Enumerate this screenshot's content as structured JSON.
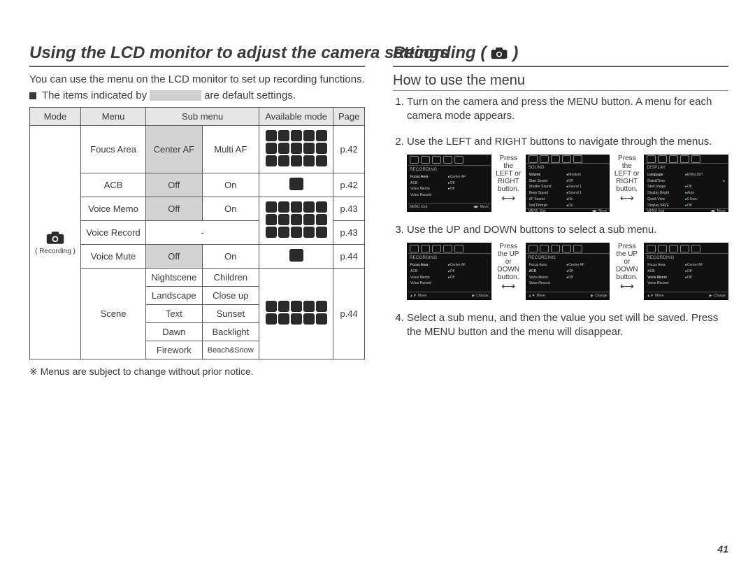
{
  "page_number": "41",
  "left": {
    "title": "Using the LCD monitor to adjust the camera settings",
    "intro": "You can use the menu on the LCD monitor to set up recording functions.",
    "default_pre": "The items indicated by",
    "default_post": "are default settings.",
    "table": {
      "headers": [
        "Mode",
        "Menu",
        "Sub menu",
        "Available mode",
        "Page"
      ],
      "mode_label": "( Recording )",
      "rows": {
        "focus_area": {
          "menu": "Foucs Area",
          "sub1": "Center AF",
          "sub2": "Multi AF",
          "page": "p.42"
        },
        "acb": {
          "menu": "ACB",
          "sub1": "Off",
          "sub2": "On",
          "page": "p.42"
        },
        "voice_memo": {
          "menu": "Voice Memo",
          "sub1": "Off",
          "sub2": "On",
          "page": "p.43"
        },
        "voice_record": {
          "menu": "Voice Record",
          "sub": "-",
          "page": "p.43"
        },
        "voice_mute": {
          "menu": "Voice Mute",
          "sub1": "Off",
          "sub2": "On",
          "page": "p.44"
        },
        "scene": {
          "menu": "Scene",
          "subs": [
            [
              "Nightscene",
              "Children"
            ],
            [
              "Landscape",
              "Close up"
            ],
            [
              "Text",
              "Sunset"
            ],
            [
              "Dawn",
              "Backlight"
            ],
            [
              "Firework",
              "Beach&Snow"
            ]
          ],
          "page": "p.44"
        }
      }
    },
    "footnote": "※ Menus are subject to change without prior notice."
  },
  "right": {
    "title": "Recording (",
    "title_end": ")",
    "subtitle": "How to use the menu",
    "steps": [
      "Turn on the camera and press the MENU button. A menu for each camera mode appears.",
      "Use the LEFT and RIGHT buttons to navigate through the menus.",
      "Use the UP and DOWN buttons to select a sub menu.",
      "Select a sub menu, and then the value you set will be saved. Press the MENU button and the menu will disappear."
    ],
    "hint_lr": "Press the LEFT or RIGHT button.",
    "hint_ud": "Press the UP or DOWN button.",
    "screens": {
      "recording": {
        "title": "RECORDING",
        "rows": [
          [
            "Focus Area",
            "Center AF"
          ],
          [
            "ACB",
            "Off"
          ],
          [
            "Voice Memo",
            "Off"
          ],
          [
            "Voice Record",
            ""
          ]
        ],
        "bottom": [
          "MENU",
          "Exit",
          "",
          "Move"
        ]
      },
      "sound": {
        "title": "SOUND",
        "rows": [
          [
            "Volume",
            "Medium"
          ],
          [
            "Start Sound",
            "Off"
          ],
          [
            "Shutter Sound",
            "Sound 1"
          ],
          [
            "Beep Sound",
            "Sound 1"
          ],
          [
            "AF Sound",
            "On"
          ],
          [
            "Self Portrait",
            "On"
          ]
        ],
        "bottom": [
          "MENU",
          "Exit",
          "",
          "Move"
        ]
      },
      "display": {
        "title": "DISPLAY",
        "rows": [
          [
            "Language",
            "ENGLISH"
          ],
          [
            "Date&Time",
            ""
          ],
          [
            "Start Image",
            "Off"
          ],
          [
            "Display Bright",
            "Auto"
          ],
          [
            "Quick View",
            "0.5sec"
          ],
          [
            "Display SAVE",
            "Off"
          ]
        ],
        "bottom": [
          "MENU",
          "Exit",
          "",
          "Move"
        ]
      },
      "rec_change": {
        "title": "RECORDING",
        "rows": [
          [
            "Focus Area",
            "Center AF"
          ],
          [
            "ACB",
            "Off"
          ],
          [
            "Voice Memo",
            "Off"
          ],
          [
            "Voice Record",
            ""
          ]
        ],
        "bottom": [
          "",
          "Move",
          "",
          "Change"
        ]
      }
    }
  }
}
